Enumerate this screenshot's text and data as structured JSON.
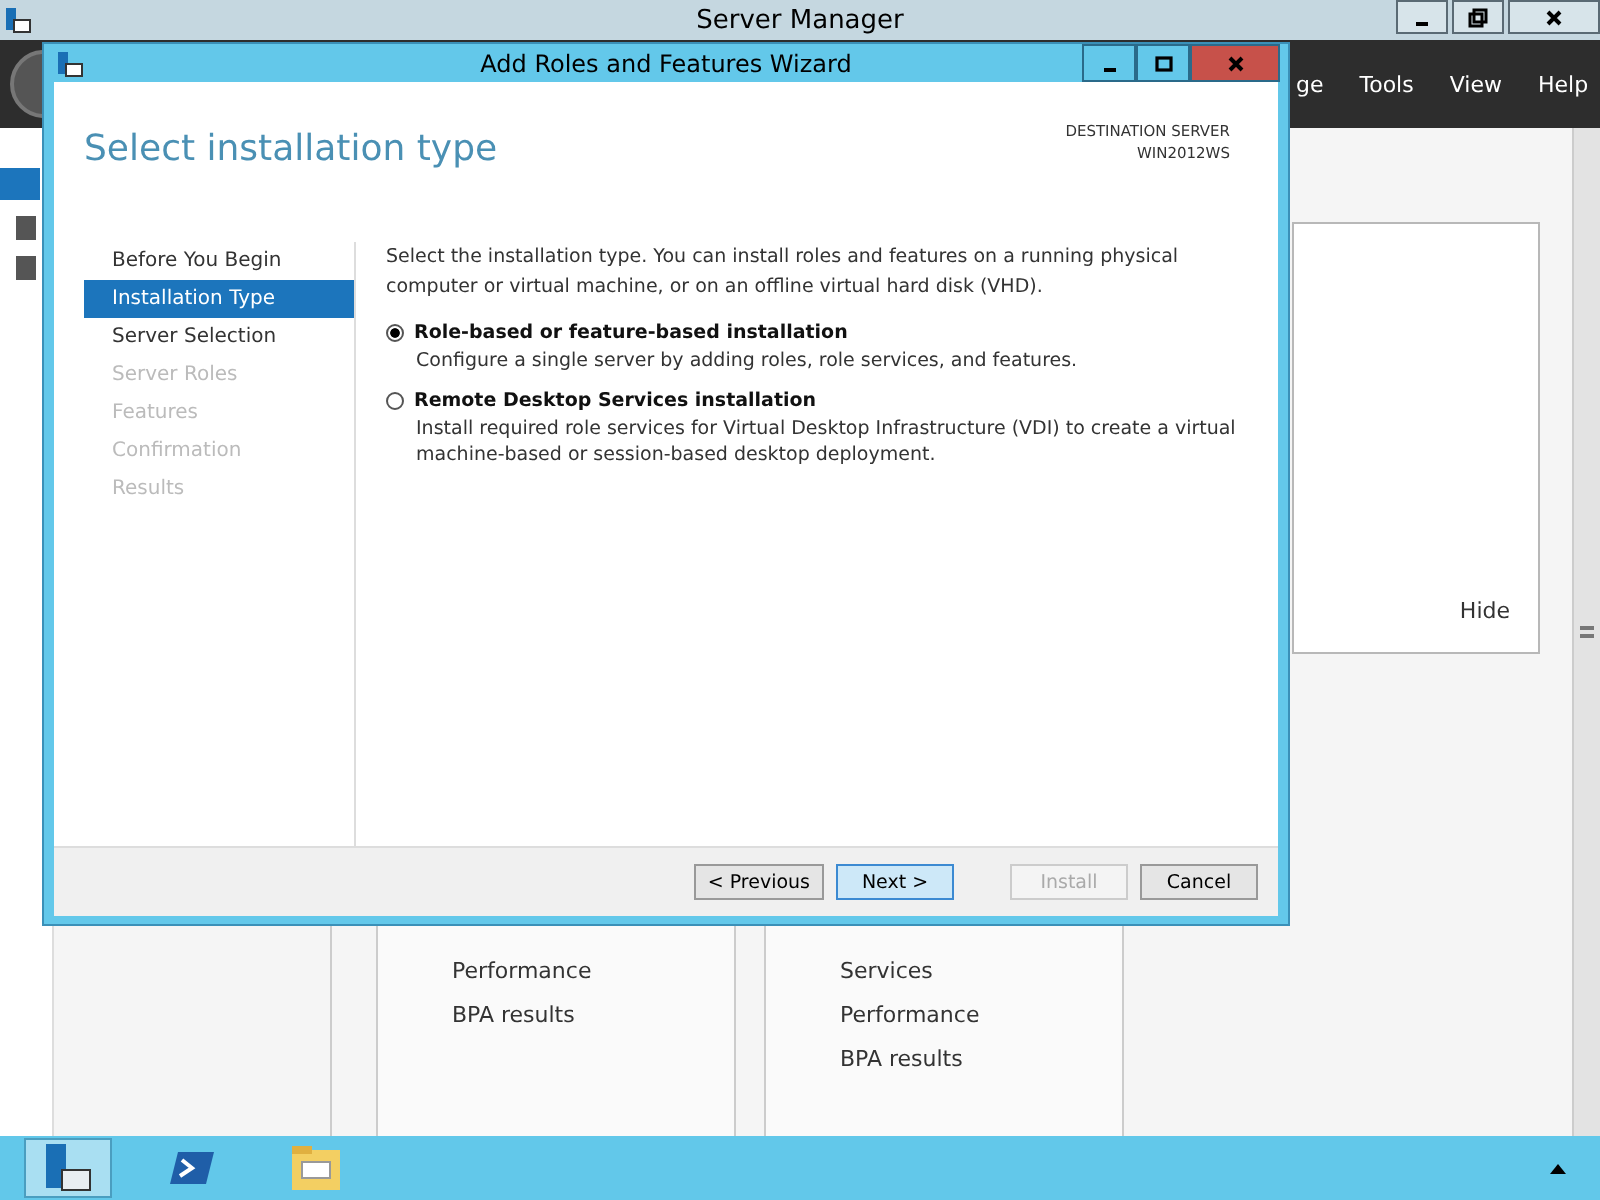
{
  "server_manager": {
    "title": "Server Manager",
    "menu": [
      "ge",
      "Tools",
      "View",
      "Help"
    ],
    "hide_link": "Hide",
    "tiles": [
      {
        "items": [
          "Performance",
          "BPA results"
        ]
      },
      {
        "items": [
          "Services",
          "Performance",
          "BPA results"
        ]
      }
    ]
  },
  "wizard": {
    "title": "Add Roles and Features Wizard",
    "heading": "Select installation type",
    "destination_label": "DESTINATION SERVER",
    "destination_server": "WIN2012WS",
    "steps": [
      {
        "label": "Before You Begin",
        "selected": false,
        "disabled": false
      },
      {
        "label": "Installation Type",
        "selected": true,
        "disabled": false
      },
      {
        "label": "Server Selection",
        "selected": false,
        "disabled": false
      },
      {
        "label": "Server Roles",
        "selected": false,
        "disabled": true
      },
      {
        "label": "Features",
        "selected": false,
        "disabled": true
      },
      {
        "label": "Confirmation",
        "selected": false,
        "disabled": true
      },
      {
        "label": "Results",
        "selected": false,
        "disabled": true
      }
    ],
    "intro": "Select the installation type. You can install roles and features on a running physical computer or virtual machine, or on an offline virtual hard disk (VHD).",
    "options": [
      {
        "label": "Role-based or feature-based installation",
        "description": "Configure a single server by adding roles, role services, and features.",
        "selected": true
      },
      {
        "label": "Remote Desktop Services installation",
        "description": "Install required role services for Virtual Desktop Infrastructure (VDI) to create a virtual machine-based or session-based desktop deployment.",
        "selected": false
      }
    ],
    "buttons": [
      {
        "label": "< Previous",
        "disabled": false,
        "default": false
      },
      {
        "label": "Next >",
        "disabled": false,
        "default": true
      },
      {
        "label": "Install",
        "disabled": true,
        "default": false
      },
      {
        "label": "Cancel",
        "disabled": false,
        "default": false
      }
    ]
  },
  "taskbar": {
    "items": [
      {
        "kind": "server-manager",
        "selected": true
      },
      {
        "kind": "powershell",
        "selected": false
      },
      {
        "kind": "explorer",
        "selected": false
      }
    ]
  }
}
